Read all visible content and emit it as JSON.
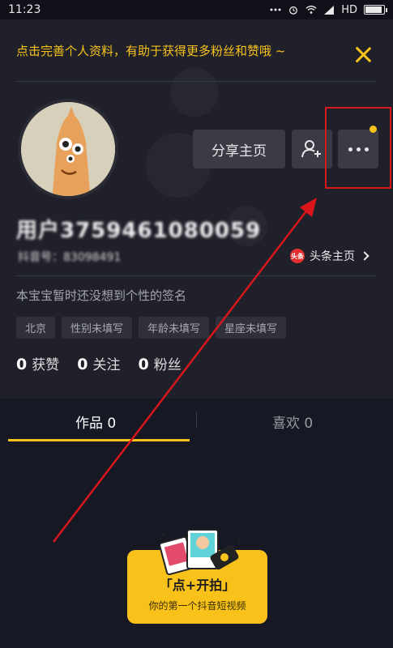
{
  "status_bar": {
    "time": "11:23",
    "network": "HD"
  },
  "tip": {
    "text": "点击完善个人资料，有助于获得更多粉丝和赞哦 ~"
  },
  "profile": {
    "share_label": "分享主页",
    "username": "用户3759461080059",
    "user_id": "抖音号：83098491",
    "toutiao_label": "头条主页",
    "toutiao_icon_text": "头条",
    "signature": "本宝宝暂时还没想到个性的签名",
    "tags": [
      "北京",
      "性别未填写",
      "年龄未填写",
      "星座未填写"
    ]
  },
  "stats": {
    "likes": {
      "count": "0",
      "label": "获赞"
    },
    "following": {
      "count": "0",
      "label": "关注"
    },
    "followers": {
      "count": "0",
      "label": "粉丝"
    }
  },
  "tabs": [
    {
      "label": "作品 0"
    },
    {
      "label": "喜欢 0"
    }
  ],
  "create_card": {
    "title": "「点+开拍」",
    "subtitle": "你的第一个抖音短视频"
  },
  "colors": {
    "accent": "#f8c21b",
    "annotation": "#d8161c",
    "background": "#161823"
  }
}
